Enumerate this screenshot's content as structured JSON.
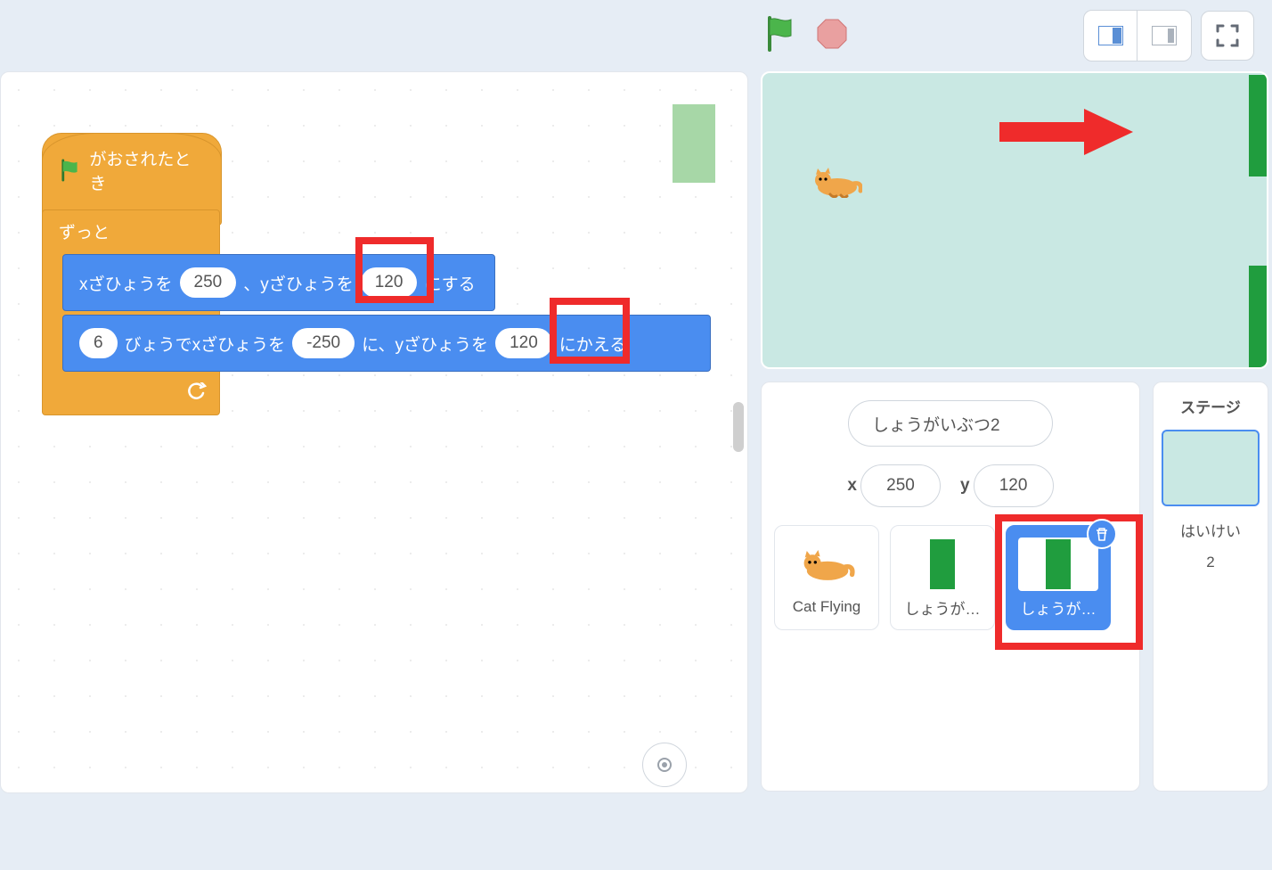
{
  "blocks": {
    "hat_label": "がおされたとき",
    "forever_label": "ずっと",
    "goto_prefix_x": "xざひょうを",
    "goto_mid": "、yざひょうを",
    "goto_suffix": "にする",
    "goto_x": "250",
    "goto_y": "120",
    "glide_secs": "6",
    "glide_after_secs": "びょうでxざひょうを",
    "glide_mid": "に、yざひょうを",
    "glide_suffix": "にかえる",
    "glide_x": "-250",
    "glide_y": "120"
  },
  "sprite": {
    "name": "しょうがいぶつ2",
    "x_label": "x",
    "y_label": "y",
    "x_value": "250",
    "y_value": "120"
  },
  "sprites": [
    {
      "label": "Cat Flying"
    },
    {
      "label": "しょうが…"
    },
    {
      "label": "しょうが…"
    }
  ],
  "stage_panel": {
    "title": "ステージ",
    "backdrop_label": "はいけい",
    "backdrop_count": "2"
  },
  "icons": {
    "flag": "green-flag-icon",
    "stop": "stop-icon",
    "small_stage": "small-stage-icon",
    "large_stage": "large-stage-icon",
    "fullscreen": "fullscreen-icon",
    "loop": "loop-arrow-icon",
    "delete": "trash-icon"
  }
}
